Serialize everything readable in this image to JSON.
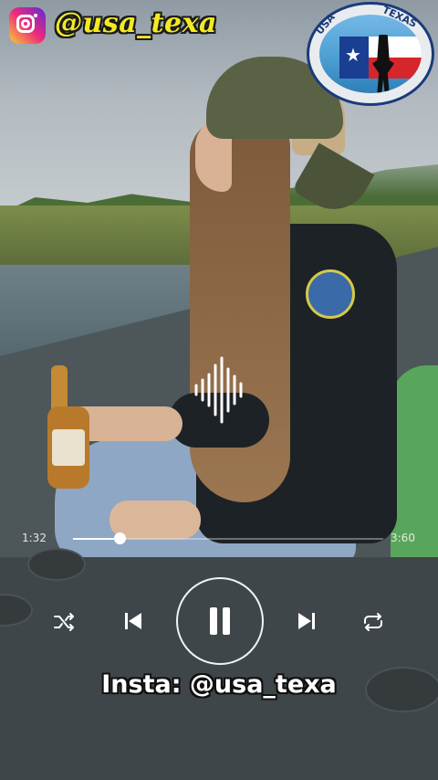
{
  "header": {
    "handle": "@usa_texa",
    "icon": "instagram-icon",
    "logo": {
      "top_left_text": "USA",
      "top_right_text": "TEXAS",
      "name": "usa-texas-logo"
    }
  },
  "player": {
    "current_time": "1:32",
    "total_time": "3:60",
    "progress": 0.15,
    "controls": [
      "shuffle-icon",
      "previous-icon",
      "pause-icon",
      "next-icon",
      "repeat-icon"
    ],
    "state": "playing"
  },
  "caption": "Insta: @usa_texa",
  "colors": {
    "handle_yellow": "#f3ea23",
    "accent_white": "#ffffff"
  }
}
